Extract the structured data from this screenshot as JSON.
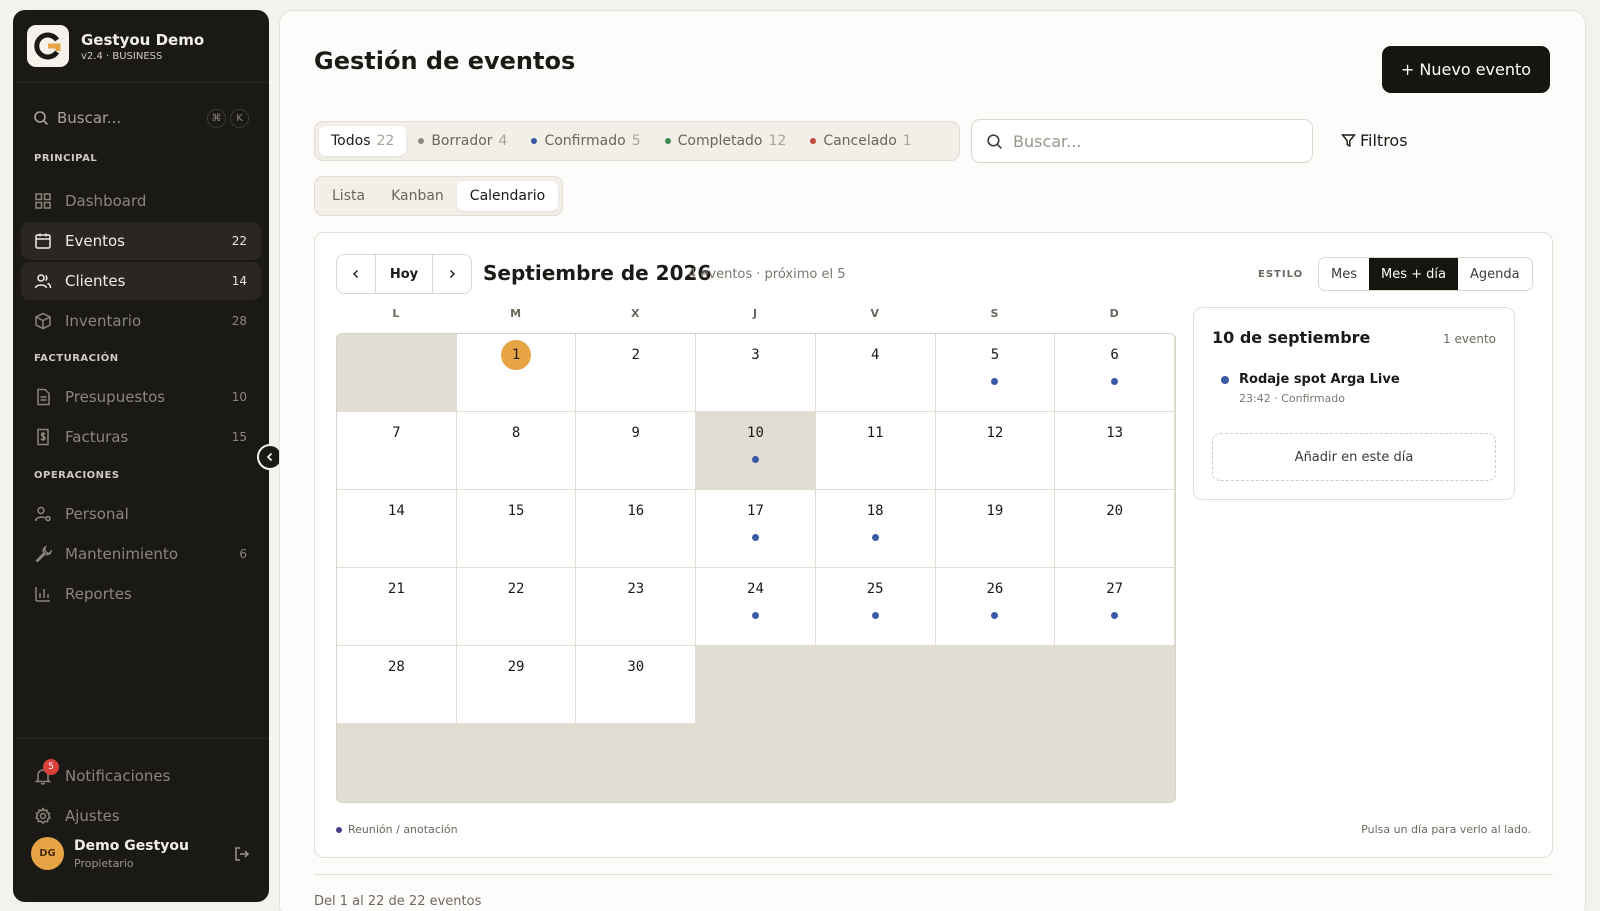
{
  "brand": {
    "name": "Gestyou Demo",
    "version": "v2.4 · BUSINESS"
  },
  "sidebar": {
    "search_placeholder": "Buscar...",
    "kbd1": "⌘",
    "kbd2": "K",
    "sections": {
      "principal": "PRINCIPAL",
      "facturacion": "FACTURACIÓN",
      "operaciones": "OPERACIONES"
    },
    "items": [
      {
        "label": "Dashboard",
        "count": ""
      },
      {
        "label": "Eventos",
        "count": "22"
      },
      {
        "label": "Clientes",
        "count": "14"
      },
      {
        "label": "Inventario",
        "count": "28"
      },
      {
        "label": "Presupuestos",
        "count": "10"
      },
      {
        "label": "Facturas",
        "count": "15"
      },
      {
        "label": "Personal",
        "count": ""
      },
      {
        "label": "Mantenimiento",
        "count": "6"
      },
      {
        "label": "Reportes",
        "count": ""
      }
    ],
    "notifications_label": "Notificaciones",
    "notifications_badge": "5",
    "settings_label": "Ajustes"
  },
  "user": {
    "initials": "DG",
    "name": "Demo Gestyou",
    "role": "Propietario"
  },
  "header": {
    "title": "Gestión de eventos",
    "new_button": "+ Nuevo evento"
  },
  "status_tabs": [
    {
      "label": "Todos",
      "count": "22",
      "color": ""
    },
    {
      "label": "Borrador",
      "count": "4",
      "color": "#8f8a80"
    },
    {
      "label": "Confirmado",
      "count": "5",
      "color": "#3a5aa6"
    },
    {
      "label": "Completado",
      "count": "12",
      "color": "#3f8a55"
    },
    {
      "label": "Cancelado",
      "count": "1",
      "color": "#c9463b"
    }
  ],
  "search": {
    "placeholder": "Buscar..."
  },
  "filters_label": "Filtros",
  "view_tabs": [
    "Lista",
    "Kanban",
    "Calendario"
  ],
  "calendar": {
    "today_label": "Hoy",
    "month_title": "Septiembre de 2026",
    "month_sub": "4 eventos · próximo el 5",
    "style_label": "ESTILO",
    "style_options": [
      "Mes",
      "Mes + día",
      "Agenda"
    ],
    "weekdays": [
      "L",
      "M",
      "X",
      "J",
      "V",
      "S",
      "D"
    ],
    "first_weekday_offset": 1,
    "days_in_month": 30,
    "today": 1,
    "selected": 10,
    "event_days": [
      5,
      6,
      10,
      17,
      18,
      24,
      25,
      26,
      27
    ],
    "legend": "Reunión / anotación",
    "hint": "Pulsa un día para verlo al lado.",
    "event_color": "#3a5aa6"
  },
  "day_panel": {
    "title": "10 de septiembre",
    "count": "1 evento",
    "event_title": "Rodaje spot Arga Live",
    "event_sub": "23:42 · Confirmado",
    "add_label": "Añadir en este día"
  },
  "footer": {
    "text": "Del 1 al 22 de 22 eventos"
  }
}
